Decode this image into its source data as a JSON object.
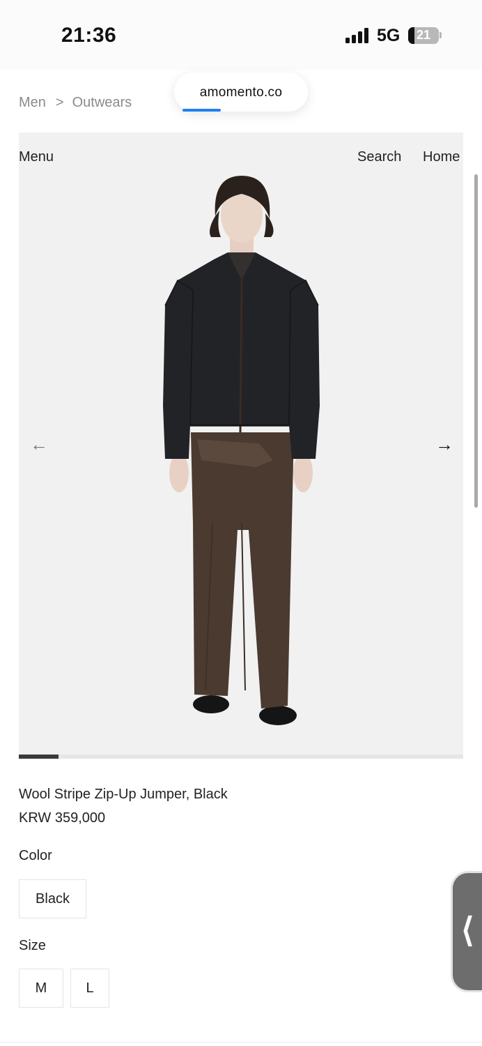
{
  "status_bar": {
    "time": "21:36",
    "network": "5G",
    "battery": "21",
    "battery_level": 0.21
  },
  "browser": {
    "url": "amomento.co",
    "load_progress": 0.35
  },
  "breadcrumb": {
    "items": [
      "Men",
      "Outwears"
    ],
    "separator": ">"
  },
  "header_nav": {
    "menu": "Menu",
    "search": "Search",
    "home": "Home"
  },
  "gallery": {
    "prev_icon": "arrow-left-icon",
    "next_icon": "arrow-right-icon",
    "position": 0.09
  },
  "product": {
    "name": "Wool Stripe Zip-Up Jumper, Black",
    "price": "KRW 359,000",
    "color_label": "Color",
    "colors": [
      "Black"
    ],
    "size_label": "Size",
    "sizes": [
      "M",
      "L"
    ]
  },
  "side_tab": {
    "icon": "chevron-left-icon"
  }
}
